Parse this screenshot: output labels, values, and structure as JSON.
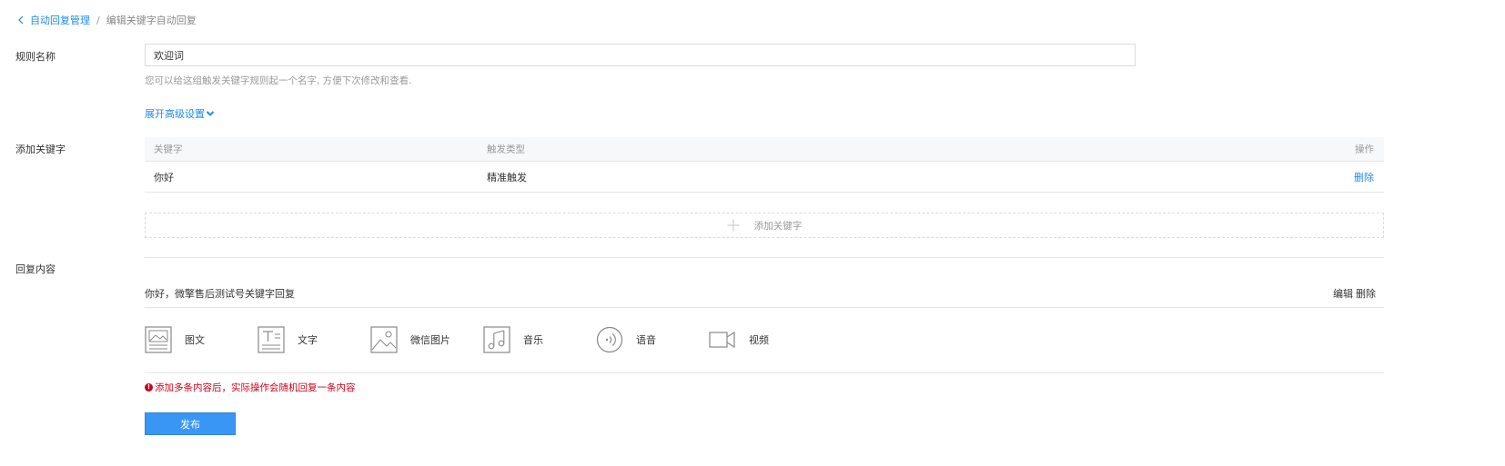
{
  "breadcrumb": {
    "parent": "自动回复管理",
    "separator": "/",
    "current": "编辑关键字自动回复"
  },
  "rule_name": {
    "label": "规则名称",
    "value": "欢迎词",
    "hint": "您可以给这组触发关键字规则起一个名字, 方便下次修改和查看."
  },
  "advanced": {
    "label": "展开高级设置"
  },
  "keywords": {
    "label": "添加关键字",
    "columns": [
      "关键字",
      "触发类型",
      "操作"
    ],
    "rows": [
      {
        "keyword": "你好",
        "trigger_type": "精准触发",
        "action": "删除"
      }
    ],
    "add_label": "添加关键字"
  },
  "reply": {
    "label": "回复内容",
    "text": "你好，微擎售后测试号关键字回复",
    "edit_label": "编辑",
    "delete_label": "删除",
    "types": [
      {
        "label": "图文",
        "icon": "news-icon"
      },
      {
        "label": "文字",
        "icon": "text-icon"
      },
      {
        "label": "微信图片",
        "icon": "image-icon"
      },
      {
        "label": "音乐",
        "icon": "music-icon"
      },
      {
        "label": "语音",
        "icon": "voice-icon"
      },
      {
        "label": "视频",
        "icon": "video-icon"
      }
    ],
    "warning": "添加多条内容后，实际操作会随机回复一条内容",
    "warning_mark": "!"
  },
  "publish_label": "发布",
  "colors": {
    "link": "#1f8ceb",
    "primary_button": "#3a96f5",
    "warning": "#d0021b"
  }
}
